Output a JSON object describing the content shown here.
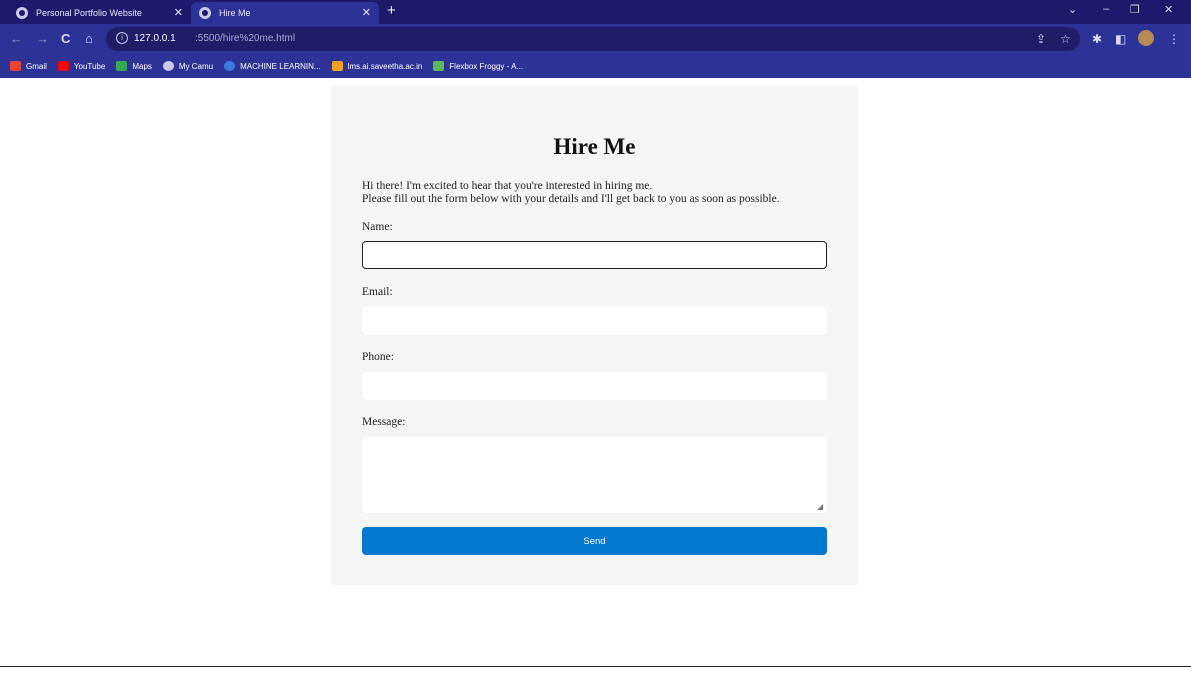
{
  "browser": {
    "tabs": [
      {
        "title": "Personal Portfolio Website",
        "close": "✕"
      },
      {
        "title": "Hire Me",
        "close": "✕"
      }
    ],
    "new_tab": "+",
    "window_controls": {
      "tab_search": "⌄",
      "minimize": "–",
      "restore": "❐",
      "close": "✕"
    },
    "nav": {
      "back": "←",
      "forward": "→",
      "reload": "C",
      "home": "⌂"
    },
    "address": {
      "host": "127.0.0.1",
      "path": ":5500/hire%20me.html",
      "info": "i"
    },
    "toolbar_icons": {
      "share": "⇪",
      "bookmark_star": "☆",
      "extensions": "✱",
      "side_panel": "◧",
      "menu": "⋮"
    },
    "bookmarks": [
      {
        "label": "Gmail",
        "color": "#ea4335"
      },
      {
        "label": "YouTube",
        "color": "#ff0000"
      },
      {
        "label": "Maps",
        "color": "#34a853"
      },
      {
        "label": "My Camu",
        "color": "#c9c9e8"
      },
      {
        "label": "MACHINE LEARNIN...",
        "color": "#3b7ddd"
      },
      {
        "label": "lms.ai.saveetha.ac.in",
        "color": "#f0a020"
      },
      {
        "label": "Flexbox Froggy - A...",
        "color": "#5cb85c"
      }
    ]
  },
  "page": {
    "title": "Hire Me",
    "intro_line1": "Hi there! I'm excited to hear that you're interested in hiring me.",
    "intro_line2": "Please fill out the form below with your details and I'll get back to you as soon as possible.",
    "form": {
      "name_label": "Name:",
      "name_value": "",
      "email_label": "Email:",
      "email_value": "",
      "phone_label": "Phone:",
      "phone_value": "",
      "message_label": "Message:",
      "message_value": "",
      "submit_label": "Send"
    },
    "colors": {
      "accent": "#0478cf",
      "chrome": "#2d3396",
      "tabstrip": "#1e1a6b",
      "card": "#f5f5f5"
    }
  }
}
